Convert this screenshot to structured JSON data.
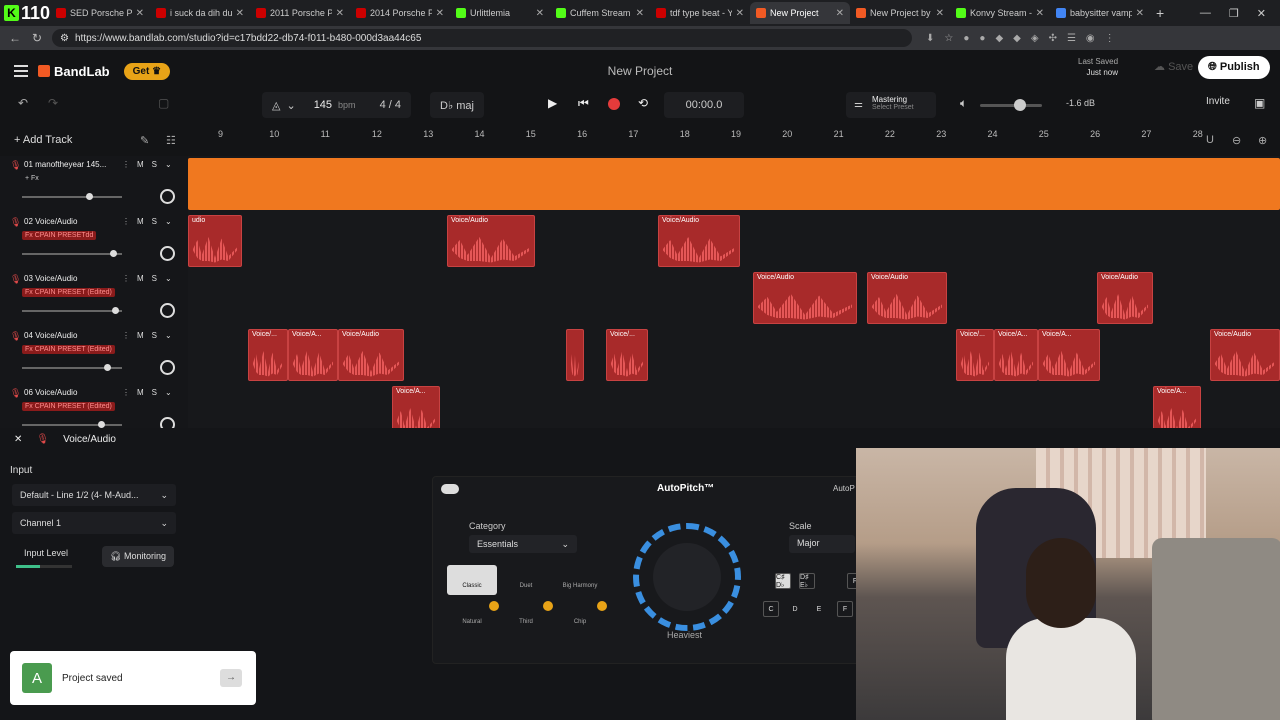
{
  "browser": {
    "kick_badge": "110",
    "tabs": [
      {
        "title": "SED Porsche Pa",
        "active": false
      },
      {
        "title": "i suck da dih duh",
        "active": false
      },
      {
        "title": "2011 Porsche Pa",
        "active": false
      },
      {
        "title": "2014 Porsche Pa",
        "active": false
      },
      {
        "title": "Urlittlemia",
        "active": false
      },
      {
        "title": "Cuffem Stream -",
        "active": false
      },
      {
        "title": "tdf type beat - Y",
        "active": false
      },
      {
        "title": "New Project",
        "active": true
      },
      {
        "title": "New Project by",
        "active": false
      },
      {
        "title": "Konvy Stream - Y",
        "active": false
      },
      {
        "title": "babysitter vamp",
        "active": false
      }
    ],
    "url": "https://www.bandlab.com/studio?id=c17bdd22-db74-f011-b480-000d3aa44c65"
  },
  "app": {
    "logo_text": "BandLab",
    "get_label": "Get",
    "project_title": "New Project",
    "last_saved_label": "Last Saved",
    "last_saved_value": "Just now",
    "save_label": "Save",
    "publish_label": "Publish",
    "invite_label": "Invite"
  },
  "transport": {
    "bpm": "145",
    "bpm_unit": "bpm",
    "time_signature": "4 / 4",
    "key": "D♭ maj",
    "time": "00:00.0",
    "mastering_label": "Mastering",
    "mastering_sub": "Select Preset",
    "volume_db": "-1.6 dB",
    "volume_level": 0.65
  },
  "timeline": {
    "add_track_label": "Add Track",
    "ruler": [
      "9",
      "10",
      "11",
      "12",
      "13",
      "14",
      "15",
      "16",
      "17",
      "18",
      "19",
      "20",
      "21",
      "22",
      "23",
      "24",
      "25",
      "26",
      "27",
      "28"
    ]
  },
  "tracks": [
    {
      "num": "01",
      "name": "manoftheyear 145...",
      "fx": "+ Fx",
      "fx_style": "plain",
      "volume": 0.68
    },
    {
      "num": "02",
      "name": "Voice/Audio",
      "fx": "Fx CPAIN PRESETdd",
      "fx_style": "red",
      "volume": 0.92
    },
    {
      "num": "03",
      "name": "Voice/Audio",
      "fx": "Fx CPAIN PRESET (Edited)",
      "fx_style": "red",
      "volume": 0.94
    },
    {
      "num": "04",
      "name": "Voice/Audio",
      "fx": "Fx CPAIN PRESET (Edited)",
      "fx_style": "red",
      "volume": 0.86
    },
    {
      "num": "06",
      "name": "Voice/Audio",
      "fx": "Fx CPAIN PRESET (Edited)",
      "fx_style": "red",
      "volume": 0.8
    }
  ],
  "clips": {
    "track1": {
      "label": ""
    },
    "track2": [
      "udio",
      "Voice/Audio",
      "Voice/Audio"
    ],
    "track3": [
      "Voice/Audio",
      "Voice/Audio",
      "Voice/Audio"
    ],
    "track4": [
      "Voice/...",
      "Voice/A...",
      "Voice/Audio",
      "",
      "Voice/...",
      "Voice/...",
      "Voice/A...",
      "Voice/A...",
      "Voice/Audio"
    ],
    "track6": [
      "Voice/A...",
      "Voice/A..."
    ]
  },
  "panel": {
    "track_title": "Voice/Audio",
    "input_label": "Input",
    "input_device": "Default - Line 1/2 (4- M-Aud...",
    "channel": "Channel 1",
    "input_level_label": "Input Level",
    "monitoring_label": "Monitoring",
    "effect": {
      "title": "AutoPitch™",
      "title_cut": "AutoP",
      "category_label": "Category",
      "category_value": "Essentials",
      "presets": [
        "Classic",
        "Duet",
        "Big Harmony",
        "Natural",
        "Third",
        "Chip"
      ],
      "knob_label": "Heaviest",
      "scale_label": "Scale",
      "scale_value": "Major",
      "keys_top": [
        "C♯ D♭",
        "D♯ E♭",
        "F"
      ],
      "keys_bottom": [
        "C",
        "D",
        "E",
        "F"
      ]
    }
  },
  "toast": {
    "icon_letter": "A",
    "message": "Project saved"
  }
}
